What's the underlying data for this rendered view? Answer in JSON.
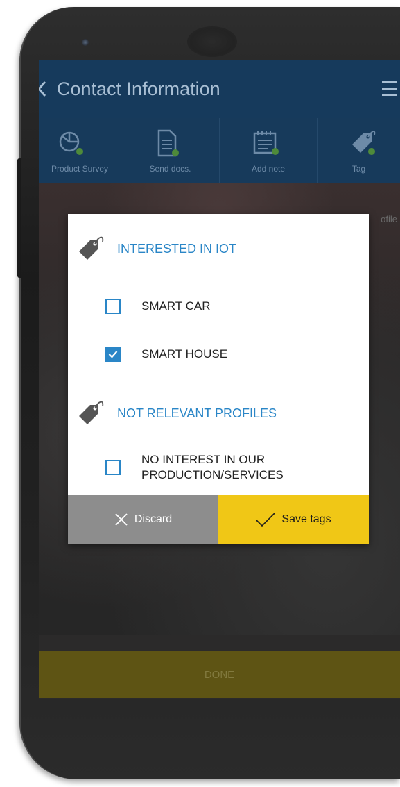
{
  "header": {
    "title": "Contact Information",
    "back_icon": "chevron-left-icon",
    "menu_icon": "menu-icon"
  },
  "toolbar": {
    "items": [
      {
        "label": "Product Survey",
        "icon": "survey-icon"
      },
      {
        "label": "Send docs.",
        "icon": "document-icon"
      },
      {
        "label": "Add note",
        "icon": "note-icon"
      },
      {
        "label": "Tag",
        "icon": "tag-icon"
      }
    ]
  },
  "background": {
    "profile_label": "ofile",
    "done_label": "DONE"
  },
  "dialog": {
    "groups": [
      {
        "title": "INTERESTED IN IOT",
        "options": [
          {
            "label": "SMART CAR",
            "checked": false
          },
          {
            "label": "SMART HOUSE",
            "checked": true
          }
        ]
      },
      {
        "title": "NOT RELEVANT PROFILES",
        "options": [
          {
            "label": "NO INTEREST IN OUR PRODUCTION/SERVICES",
            "line1": "NO INTEREST IN OUR",
            "line2": "PRODUCTION/SERVICES",
            "checked": false
          }
        ]
      }
    ],
    "discard_label": "Discard",
    "save_label": "Save tags"
  },
  "colors": {
    "app_bar": "#163a5c",
    "accent_blue": "#2a86c7",
    "save_yellow": "#f0c716",
    "discard_gray": "#8d8d8d"
  }
}
